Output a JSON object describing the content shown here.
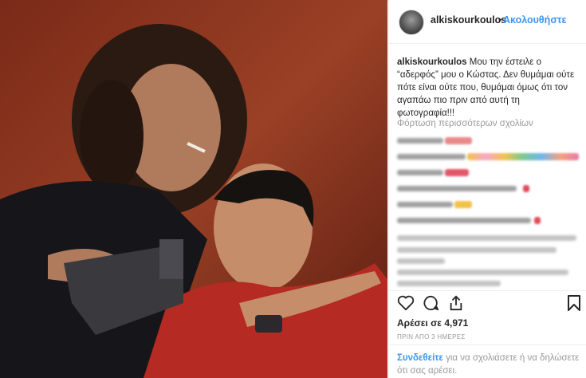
{
  "header": {
    "username": "alkiskourkoulos",
    "separator": "•",
    "follow_label": "Ακολουθήστε"
  },
  "caption": {
    "username": "alkiskourkoulos",
    "text": "Μου την έστειλε ο “αδερφός” μου ο Κώστας. Δεν θυμάμαι ούτε πότε είναι ούτε που, θυμάμαι όμως ότι τον αγαπάω πιο πριν από αυτή τη φωτογραφία!!!"
  },
  "comments": {
    "load_more": "Φόρτωση περισσότερων σχολίων"
  },
  "actions": {
    "like_icon": "heart-icon",
    "comment_icon": "speech-bubble-icon",
    "share_icon": "share-icon",
    "save_icon": "bookmark-icon"
  },
  "likes": "Αρέσει σε 4,971",
  "time_ago": "ΠΡΙΝ ΑΠΟ 3 ΗΜΕΡΕΣ",
  "login": {
    "link": "Συνδεθείτε",
    "text": " για να σχολιάσετε ή να δηλώσετε ότι σας αρέσει."
  },
  "colors": {
    "accent": "#3897f0",
    "text": "#262626",
    "muted": "#999999"
  }
}
